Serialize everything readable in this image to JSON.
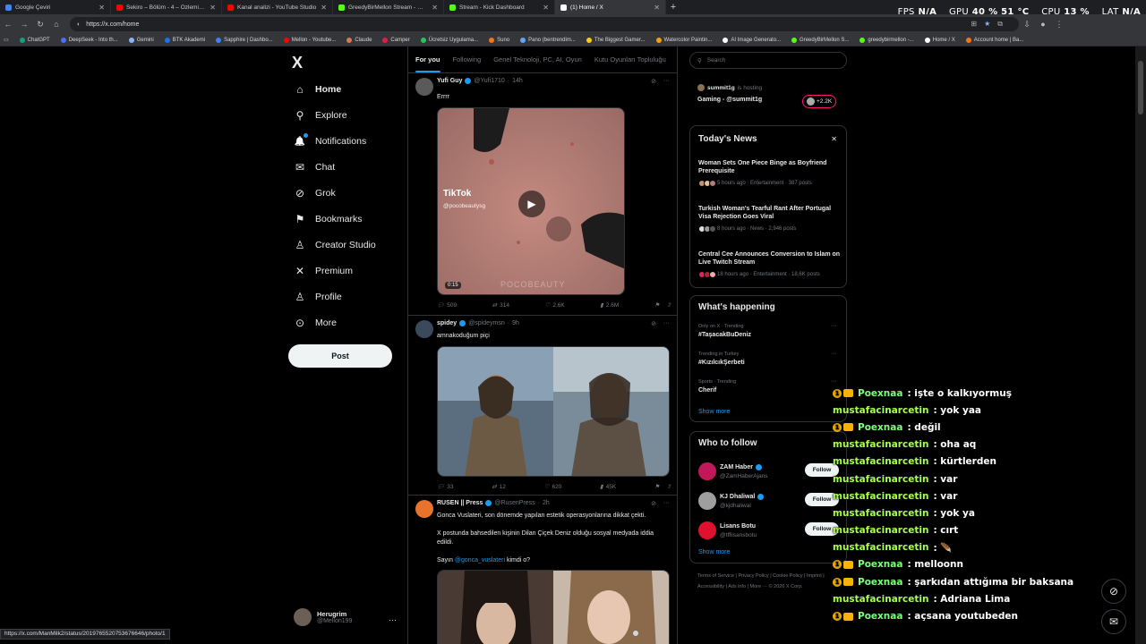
{
  "browser": {
    "tabs": [
      {
        "title": "Google Çeviri",
        "color": "#4285f4"
      },
      {
        "title": "Sekiro – Bölüm - 4 – Özlemiğim !!!",
        "color": "#ff0000"
      },
      {
        "title": "Kanal analizi - YouTube Studio",
        "color": "#ff0000"
      },
      {
        "title": "GreedyBirMellon Stream - Watch Liv...",
        "color": "#53fc18"
      },
      {
        "title": "Stream - Kick Dashboard",
        "color": "#53fc18"
      },
      {
        "title": "(1) Home / X",
        "color": "#ffffff",
        "active": true
      }
    ],
    "new_tab": "+",
    "url": "https://x.com/home",
    "hud": {
      "fps_label": "FPS",
      "fps_value": "N/A",
      "gpu_label": "GPU",
      "gpu_value": "40 % 51 °C",
      "cpu_label": "CPU",
      "cpu_value": "13 %",
      "lat_label": "LAT",
      "lat_value": "N/A"
    },
    "bookmarks": [
      {
        "label": "ChatGPT",
        "color": "#10a37f"
      },
      {
        "label": "DeepSeek - Into th...",
        "color": "#4d6bfe"
      },
      {
        "label": "Gemini",
        "color": "#8ab4f8"
      },
      {
        "label": "BTK Akademi",
        "color": "#1a73e8"
      },
      {
        "label": "Sapphire | Dashbo...",
        "color": "#3b82f6"
      },
      {
        "label": "Mellon - Youtube...",
        "color": "#ff0000"
      },
      {
        "label": "Claude",
        "color": "#d97757"
      },
      {
        "label": "Camper",
        "color": "#e11d48"
      },
      {
        "label": "Ücretsiz Uygulama...",
        "color": "#22c55e"
      },
      {
        "label": "Suno",
        "color": "#f97316"
      },
      {
        "label": "Pano (bentrendim...",
        "color": "#60a5fa"
      },
      {
        "label": "The Biggest Gamer...",
        "color": "#facc15"
      },
      {
        "label": "Watercolor Paintin...",
        "color": "#f59e0b"
      },
      {
        "label": "AI Image Generato...",
        "color": "#ffffff"
      },
      {
        "label": "GreedyBirMellon S...",
        "color": "#53fc18"
      },
      {
        "label": "greedybirmellon -...",
        "color": "#53fc18"
      },
      {
        "label": "Home / X",
        "color": "#ffffff"
      },
      {
        "label": "Account home | Ba...",
        "color": "#f97316"
      }
    ],
    "status_url": "https://x.com/ManMilk2/status/2019765520753676646/photo/1"
  },
  "nav": {
    "logo": "X",
    "items": [
      {
        "label": "Home",
        "icon": "home-icon",
        "glyph": "⌂"
      },
      {
        "label": "Explore",
        "icon": "search-icon",
        "glyph": "⚲"
      },
      {
        "label": "Notifications",
        "icon": "bell-icon",
        "glyph": "🔔"
      },
      {
        "label": "Chat",
        "icon": "mail-icon",
        "glyph": "✉"
      },
      {
        "label": "Grok",
        "icon": "grok-icon",
        "glyph": "⊘"
      },
      {
        "label": "Bookmarks",
        "icon": "bookmark-icon",
        "glyph": "⚑"
      },
      {
        "label": "Creator Studio",
        "icon": "creator-icon",
        "glyph": "♙"
      },
      {
        "label": "Premium",
        "icon": "x-premium-icon",
        "glyph": "✕"
      },
      {
        "label": "Profile",
        "icon": "profile-icon",
        "glyph": "♙"
      },
      {
        "label": "More",
        "icon": "more-circle-icon",
        "glyph": "⊙"
      }
    ],
    "post_label": "Post",
    "user": {
      "name": "Herugrim",
      "handle": "@Mellon199",
      "more": "···"
    }
  },
  "timeline": {
    "tabs": [
      "For you",
      "Following",
      "Genel Teknoloji, PC, AI, Oyun",
      "Kutu Oyunları Topluluğu"
    ],
    "tweets": [
      {
        "name": "Yufi Guy",
        "handle": "@Yufi1710",
        "time": "14h",
        "text": "Errrr",
        "video": {
          "brand": "TikTok",
          "handle": "@pocobeautysg",
          "watermark": "POCOBEAUTY",
          "duration": "0:15"
        },
        "stats": {
          "replies": "509",
          "reposts": "314",
          "likes": "2.6K",
          "views": "2.6M"
        }
      },
      {
        "name": "spidey",
        "handle": "@spideymsn",
        "time": "9h",
        "text": "amnakoduğum piçi",
        "stats": {
          "replies": "33",
          "reposts": "12",
          "likes": "620",
          "views": "45K"
        }
      },
      {
        "name": "RUSEN || Press",
        "handle": "@RusenPress",
        "time": "2h",
        "text1": "Gonca Vuslateri, son dönemde yapılan estetik operasyonlarına dikkat çekti.",
        "text2": "X postunda bahsedilen kişinin Dilan Çiçek Deniz olduğu sosyal medyada iddia edildi.",
        "text3_pre": "Sayın ",
        "text3_link": "@gonca_vuslateri",
        "text3_post": " kimdi o?"
      }
    ]
  },
  "right": {
    "search_placeholder": "Search",
    "live": {
      "name": "summit1g",
      "status": "is hosting",
      "title": "Gaming - @summit1g",
      "count": "+2.2K"
    },
    "news": {
      "title": "Today's News",
      "close": "✕",
      "items": [
        {
          "headline": "Woman Sets One Piece Binge as Boyfriend Prerequisite",
          "meta": "5 hours ago · Entertainment · 387 posts"
        },
        {
          "headline": "Turkish Woman's Tearful Rant After Portugal Visa Rejection Goes Viral",
          "meta": "8 hours ago · News · 2,946 posts"
        },
        {
          "headline": "Central Cee Announces Conversion to Islam on Live Twitch Stream",
          "meta": "18 hours ago · Entertainment · 18.6K posts"
        }
      ]
    },
    "happening": {
      "title": "What's happening",
      "trends": [
        {
          "context": "Only on X · Trending",
          "name": "#TaşacakBuDeniz"
        },
        {
          "context": "Trending in Turkey",
          "name": "#KızılcıkŞerbeti"
        },
        {
          "context": "Sports · Trending",
          "name": "Cherif"
        }
      ],
      "show_more": "Show more"
    },
    "who": {
      "title": "Who to follow",
      "users": [
        {
          "name": "ZAM Haber",
          "handle": "@ZamHaberAjans",
          "color": "#c2185b",
          "verified": true
        },
        {
          "name": "KJ Dhaliwal",
          "handle": "@kjdhaliwal",
          "color": "#9e9e9e",
          "verified": true
        },
        {
          "name": "Lisans Botu",
          "handle": "@tffiisansbotu",
          "color": "#e0102f",
          "verified": false
        }
      ],
      "follow_label": "Follow",
      "show_more": "Show more"
    },
    "footer": "Terms of Service | Privacy Policy | Cookie Policy | Imprint | Accessibility | Ads info | More ··· © 2026 X Corp."
  },
  "chat": [
    {
      "user": "Poexnaa",
      "msg": ": işte o kalkıyormuş",
      "color": "#7dff7d",
      "badges": true
    },
    {
      "user": "mustafacinarcetin",
      "msg": ": yok yaa",
      "color": "#a6ff4d",
      "badges": false
    },
    {
      "user": "Poexnaa",
      "msg": ": değil",
      "color": "#7dff7d",
      "badges": true
    },
    {
      "user": "mustafacinarcetin",
      "msg": ": oha aq",
      "color": "#a6ff4d",
      "badges": false
    },
    {
      "user": "mustafacinarcetin",
      "msg": ": kürtlerden",
      "color": "#a6ff4d",
      "badges": false
    },
    {
      "user": "mustafacinarcetin",
      "msg": ": var",
      "color": "#a6ff4d",
      "badges": false
    },
    {
      "user": "mustafacinarcetin",
      "msg": ": var",
      "color": "#a6ff4d",
      "badges": false
    },
    {
      "user": "mustafacinarcetin",
      "msg": ": yok ya",
      "color": "#a6ff4d",
      "badges": false
    },
    {
      "user": "mustafacinarcetin",
      "msg": ": cırt",
      "color": "#a6ff4d",
      "badges": false
    },
    {
      "user": "mustafacinarcetin",
      "msg": ": 🪶",
      "color": "#a6ff4d",
      "badges": false
    },
    {
      "user": "Poexnaa",
      "msg": ": melloonn",
      "color": "#7dff7d",
      "badges": true
    },
    {
      "user": "Poexnaa",
      "msg": ": şarkıdan attığıma bir baksana",
      "color": "#7dff7d",
      "badges": true
    },
    {
      "user": "mustafacinarcetin",
      "msg": ": Adriana Lima",
      "color": "#a6ff4d",
      "badges": false
    },
    {
      "user": "Poexnaa",
      "msg": ": açsana youtubeden",
      "color": "#7dff7d",
      "badges": true
    }
  ],
  "chat_badge": "1"
}
